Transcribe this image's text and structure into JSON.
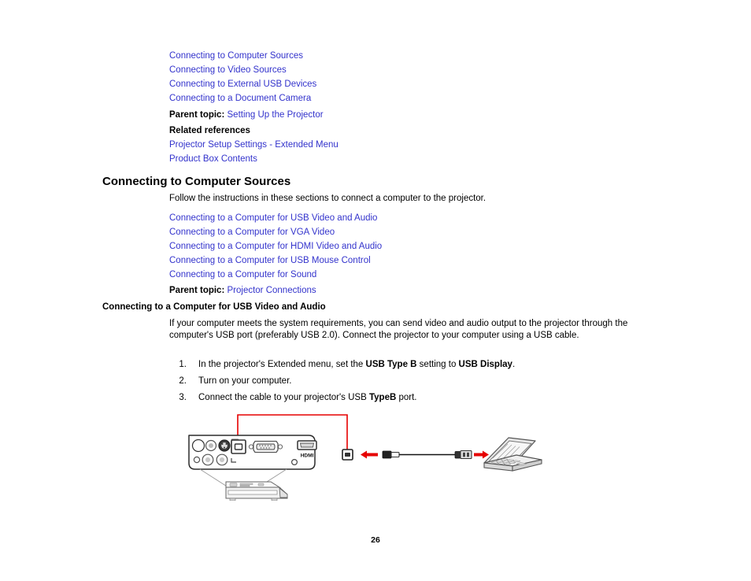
{
  "top_links": [
    {
      "label": "Connecting to Computer Sources"
    },
    {
      "label": "Connecting to Video Sources"
    },
    {
      "label": "Connecting to External USB Devices"
    },
    {
      "label": "Connecting to a Document Camera"
    }
  ],
  "parent_topic_1": {
    "label": "Parent topic:",
    "link": "Setting Up the Projector"
  },
  "related_references": {
    "heading": "Related references",
    "links": [
      {
        "label": "Projector Setup Settings - Extended Menu"
      },
      {
        "label": "Product Box Contents"
      }
    ]
  },
  "section": {
    "title": "Connecting to Computer Sources",
    "intro": "Follow the instructions in these sections to connect a computer to the projector.",
    "links": [
      {
        "label": "Connecting to a Computer for USB Video and Audio"
      },
      {
        "label": "Connecting to a Computer for VGA Video"
      },
      {
        "label": "Connecting to a Computer for HDMI Video and Audio"
      },
      {
        "label": "Connecting to a Computer for USB Mouse Control"
      },
      {
        "label": "Connecting to a Computer for Sound"
      }
    ],
    "parent_topic": {
      "label": "Parent topic:",
      "link": "Projector Connections"
    }
  },
  "subsection": {
    "title": "Connecting to a Computer for USB Video and Audio",
    "body": "If your computer meets the system requirements, you can send video and audio output to the projector through the computer's USB port (preferably USB 2.0). Connect the projector to your computer using a USB cable.",
    "steps": [
      {
        "number": "1.",
        "parts": [
          {
            "text": "In the projector's Extended menu, set the ",
            "bold": false
          },
          {
            "text": "USB Type B",
            "bold": true
          },
          {
            "text": " setting to ",
            "bold": false
          },
          {
            "text": "USB Display",
            "bold": true
          },
          {
            "text": ".",
            "bold": false
          }
        ]
      },
      {
        "number": "2.",
        "parts": [
          {
            "text": "Turn on your computer.",
            "bold": false
          }
        ]
      },
      {
        "number": "3.",
        "parts": [
          {
            "text": "Connect the cable to your projector's USB ",
            "bold": false
          },
          {
            "text": "TypeB",
            "bold": true
          },
          {
            "text": " port.",
            "bold": false
          }
        ]
      }
    ]
  },
  "figure": {
    "caption": "",
    "hdmi_label": "HDMI",
    "callout_color": "#e60000",
    "arrow_color": "#e60000",
    "parts": [
      "projector-rear-panel",
      "usb-type-b-port",
      "vga-port",
      "hdmi-port",
      "audio-video-ports",
      "usb-cable",
      "laptop-computer",
      "projector-body"
    ]
  },
  "page_number": "26",
  "colors": {
    "link": "#3333cc",
    "text": "#000000",
    "callout": "#e60000",
    "background": "#ffffff"
  }
}
